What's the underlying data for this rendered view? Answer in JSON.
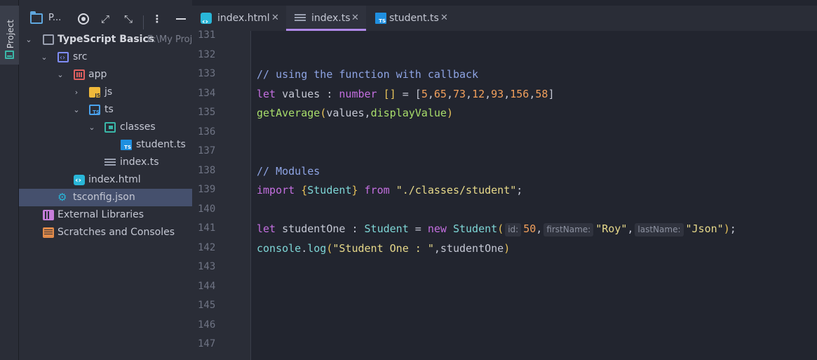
{
  "colors": {
    "background": "#22252f",
    "panel": "#2a2d37",
    "selection": "#45506d",
    "active_tab_accent": "#b089e8"
  },
  "toolwindow": {
    "label": "Project",
    "icon": "project-window-icon"
  },
  "project_panel": {
    "title": "P...",
    "buttons": [
      "target-icon",
      "expand-icon",
      "collapse-icon",
      "more-icon",
      "minimize-icon"
    ],
    "tree": [
      {
        "label": "TypeScript Basics",
        "path": "E:\\My Proj",
        "icon": "project-folder-icon",
        "bold": true
      },
      {
        "label": "src",
        "icon": "source-folder-icon"
      },
      {
        "label": "app",
        "icon": "app-folder-icon"
      },
      {
        "label": "js",
        "icon": "js-folder-icon"
      },
      {
        "label": "ts",
        "icon": "ts-folder-icon"
      },
      {
        "label": "classes",
        "icon": "classes-folder-icon"
      },
      {
        "label": "student.ts",
        "icon": "typescript-file-icon"
      },
      {
        "label": "index.ts",
        "icon": "structure-file-icon"
      },
      {
        "label": "index.html",
        "icon": "html-file-icon"
      },
      {
        "label": "tsconfig.json",
        "icon": "json-config-icon",
        "selected": true
      },
      {
        "label": "External Libraries",
        "icon": "library-icon"
      },
      {
        "label": "Scratches and Consoles",
        "icon": "scratches-icon"
      }
    ]
  },
  "tabs": [
    {
      "label": "index.html",
      "icon": "html-file-icon",
      "active": false
    },
    {
      "label": "index.ts",
      "icon": "structure-file-icon",
      "active": true
    },
    {
      "label": "student.ts",
      "icon": "typescript-file-icon",
      "active": false
    }
  ],
  "close_glyph": "✕",
  "editor": {
    "line_numbers": [
      "131",
      "132",
      "133",
      "134",
      "135",
      "136",
      "137",
      "138",
      "139",
      "140",
      "141",
      "142",
      "143",
      "144",
      "145",
      "146",
      "147"
    ],
    "lines": {
      "l133": "// using the function with callback",
      "l134": {
        "kw": "let",
        "name": " values : ",
        "type": "number",
        "br": " []",
        "eq": " = [",
        "nums": [
          "5",
          "65",
          "73",
          "12",
          "93",
          "156",
          "58"
        ],
        "end": "]"
      },
      "l135": {
        "fn": "getAverage",
        "open": "(",
        "args": "values,",
        "cb": "displayValue",
        "close": ")"
      },
      "l138": "// Modules",
      "l139": {
        "kw": "import",
        "open": " {",
        "name": "Student",
        "close": "}",
        "from": " from ",
        "str": "\"./classes/student\"",
        "end": ";"
      },
      "l141": {
        "kw": "let",
        "name": " studentOne : ",
        "type": "Student",
        "eq": " = ",
        "kw2": "new",
        "cls": " Student",
        "open": "(",
        "hint1": "id:",
        "v1": "50",
        "sep": ",",
        "hint2": "firstName:",
        "v2": "\"Roy\"",
        "hint3": "lastName:",
        "v3": "\"Json\"",
        "close": ")",
        "end": ";"
      },
      "l142": {
        "obj": "console",
        "dot": ".",
        "fn": "log",
        "open": "(",
        "str": "\"Student One : \"",
        "args": ",studentOne",
        "close": ")"
      }
    }
  }
}
